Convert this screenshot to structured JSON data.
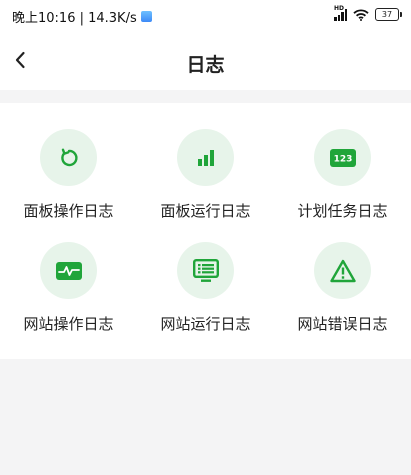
{
  "status_bar": {
    "time_text": "晚上10:16 | 14.3K/s",
    "signal_label": "HD",
    "battery_level": "37"
  },
  "header": {
    "title": "日志"
  },
  "log_items": [
    {
      "label": "面板操作日志",
      "icon": "refresh-icon"
    },
    {
      "label": "面板运行日志",
      "icon": "bar-chart-icon"
    },
    {
      "label": "计划任务日志",
      "icon": "number-badge-icon",
      "icon_text": "123"
    },
    {
      "label": "网站操作日志",
      "icon": "pulse-icon"
    },
    {
      "label": "网站运行日志",
      "icon": "monitor-list-icon"
    },
    {
      "label": "网站错误日志",
      "icon": "warning-icon"
    }
  ],
  "colors": {
    "accent_green": "#20a53a",
    "icon_circle_bg": "#e7f4ea",
    "page_bg": "#f4f4f5"
  }
}
